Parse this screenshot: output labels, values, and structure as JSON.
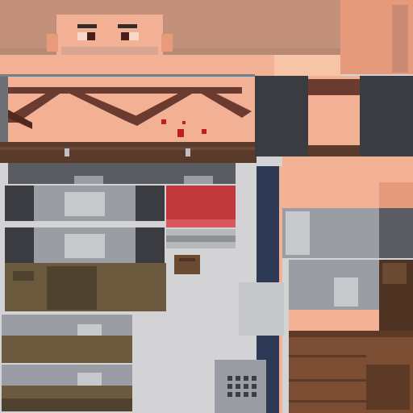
{
  "texture": {
    "kind": "pixel-art character skin atlas",
    "palette": {
      "background": "#d3d3d5",
      "skin": "#f2b194",
      "skin_shadow": "#e89a7d",
      "skin_light": "#f7c4a8",
      "hair": "#c39079",
      "hair_dark": "#b07d66",
      "beard": "#d9a593",
      "eye": "#4a1d1d",
      "strap": "#6b3b2f",
      "strap_dark": "#52291f",
      "blood": "#c21e1e",
      "belt": "#5a3a2a",
      "steel": "#9a9da3",
      "steel_dark": "#5a5c61",
      "steel_light": "#c7c9cd",
      "cloth_dark": "#3a3c42",
      "navy": "#2e3a55",
      "red_cloth": "#c1393c",
      "leather": "#6a4a32",
      "leather_dark": "#4e3323",
      "wood": "#7b4e33",
      "wood_dark": "#5c3a25",
      "khaki": "#6b5a3e",
      "khaki_dark": "#4f4330",
      "grate": "#3b3d44"
    },
    "regions": [
      "head-top",
      "face",
      "torso-front",
      "torso-side",
      "belt",
      "arm-armor-left",
      "arm-armor-right",
      "red-cloth-swatch",
      "leg-section-upper",
      "leg-section-lower",
      "boot-left",
      "boot-right",
      "pouch",
      "vent-grate"
    ]
  }
}
